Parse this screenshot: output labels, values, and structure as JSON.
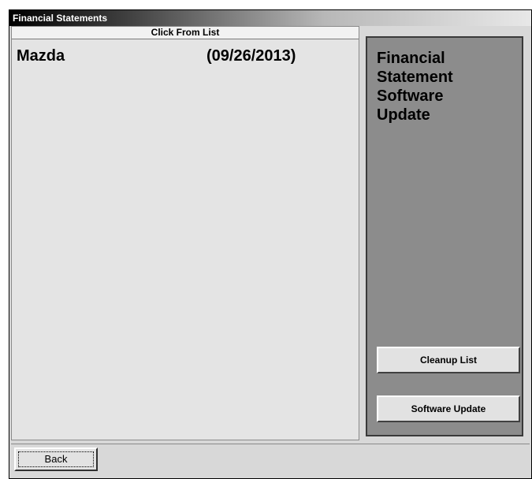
{
  "window": {
    "title": "Financial Statements"
  },
  "list": {
    "header": "Click From List",
    "items": [
      {
        "name": "Mazda",
        "date": "(09/26/2013)"
      }
    ]
  },
  "side_panel": {
    "title_lines": [
      "Financial",
      "Statement",
      "Software",
      "Update"
    ],
    "cleanup_label": "Cleanup List",
    "software_update_label": "Software Update"
  },
  "footer": {
    "back_label": "Back"
  },
  "colors": {
    "side_panel_bg": "#8c8c8c",
    "window_bg": "#d8d8d8"
  }
}
